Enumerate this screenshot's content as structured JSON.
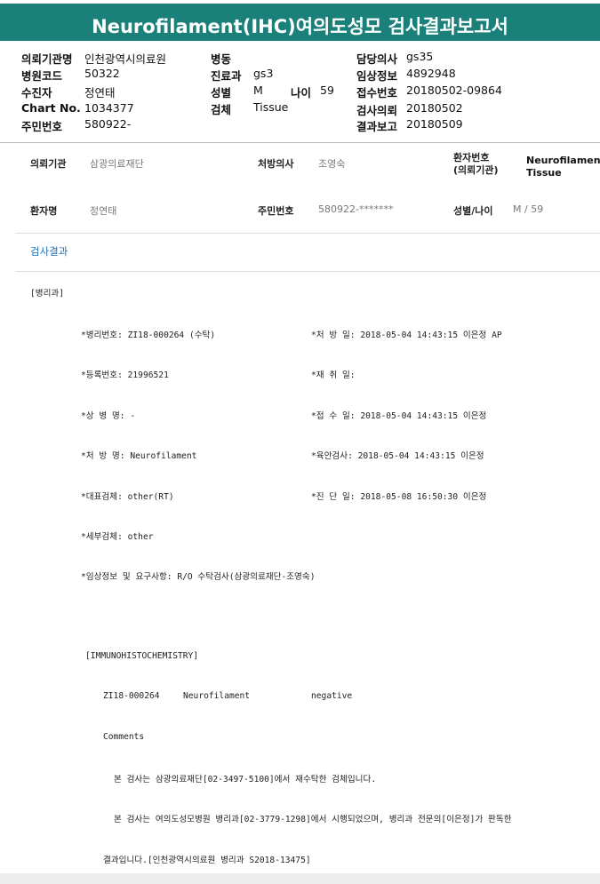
{
  "title": "Neurofilament(IHC)여의도성모 검사결과보고서",
  "header": {
    "col1": [
      {
        "label": "의뢰기관명",
        "value": "인천광역시의료원"
      },
      {
        "label": "병원코드",
        "value": "50322"
      },
      {
        "label": "수진자",
        "value": "정연태"
      },
      {
        "label": "Chart No.",
        "value": "1034377"
      },
      {
        "label": "주민번호",
        "value": "580922-"
      }
    ],
    "col2": [
      {
        "label": "병동",
        "value": ""
      },
      {
        "label": "진료과",
        "value": "gs3"
      },
      {
        "label": "성별",
        "value": "M"
      },
      {
        "label": "검체",
        "value": "Tissue"
      }
    ],
    "age_label": "나이",
    "age_value": "59",
    "col3": [
      {
        "label": "담당의사",
        "value": "gs35"
      },
      {
        "label": "임상정보",
        "value": "4892948"
      },
      {
        "label": "접수번호",
        "value": "20180502-09864"
      },
      {
        "label": "검사의뢰",
        "value": "20180502"
      },
      {
        "label": "결과보고",
        "value": "20180509"
      }
    ]
  },
  "info": {
    "inst_label": "의뢰기관",
    "inst_value": "삼광의료재단",
    "doctor_label": "처방의사",
    "doctor_value": "조영숙",
    "patno_label_1": "환자번호",
    "patno_label_2": "(의뢰기관)",
    "right_1": "Neurofilamen",
    "right_2": "Tissue",
    "name_label": "환자명",
    "name_value": "정연태",
    "rrn_label": "주민번호",
    "rrn_value": "580922-*******",
    "sexage_label": "성별/나이",
    "sexage_value": "M / 59"
  },
  "section_title": "검사결과",
  "report": {
    "dept": "[병리과]",
    "left": [
      "*병리번호: ZI18-000264 (수탁)",
      "*등록번호: 21996521",
      "*상 병 명: -",
      "*처 방 명: Neurofilament",
      "*대표검체: other(RT)",
      "*세부검체: other",
      "*임상정보 및 요구사항: R/O 수탁검사(삼광의료재단-조영숙)"
    ],
    "right": [
      "*처 방 일: 2018-05-04 14:43:15  이은정 AP",
      "*재 취 일:",
      "*접 수 일: 2018-05-04 14:43:15  이은정",
      "*육안검사: 2018-05-04 14:43:15  이은정",
      "*진 단 일: 2018-05-08 16:50:30  이은정"
    ],
    "ihc_header": "[IMMUNOHISTOCHEMISTRY]",
    "ihc_id": "ZI18-000264",
    "ihc_marker": "Neurofilament",
    "ihc_result": "negative",
    "comments_label": "Comments",
    "comment_1": "본 검사는 삼광의료재단[02-3497-5100]에서 재수탁한 검체입니다.",
    "comment_2": "본 검사는 여의도성모병원 병리과[02-3779-1298]에서 시행되었으며, 병리과 전문의[이은정]가 판독한",
    "comment_3": "결과입니다.[인천광역시의료원 병리과  S2018-13475]"
  }
}
